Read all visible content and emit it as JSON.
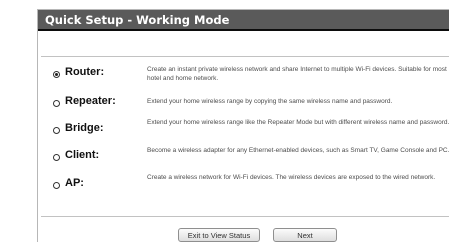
{
  "header": {
    "title": "Quick Setup - Working Mode"
  },
  "modes": [
    {
      "label": "Router:",
      "selected": true,
      "description": "Create an instant private wireless network and share Internet to multiple Wi-Fi devices. Suitable for most hotel and home network."
    },
    {
      "label": "Repeater:",
      "selected": false,
      "description": "Extend your home wireless range by copying the same wireless name and password."
    },
    {
      "label": "Bridge:",
      "selected": false,
      "description": "Extend your home wireless range like the Repeater Mode but with different wireless name and password."
    },
    {
      "label": "Client:",
      "selected": false,
      "description": "Become a wireless adapter for any Ethernet-enabled devices, such as Smart TV, Game Console and PC."
    },
    {
      "label": "AP:",
      "selected": false,
      "description": "Create a wireless network for Wi-Fi devices. The wireless devices are exposed to the wired network."
    }
  ],
  "buttons": {
    "exit_label": "Exit to View Status",
    "next_label": "Next"
  }
}
